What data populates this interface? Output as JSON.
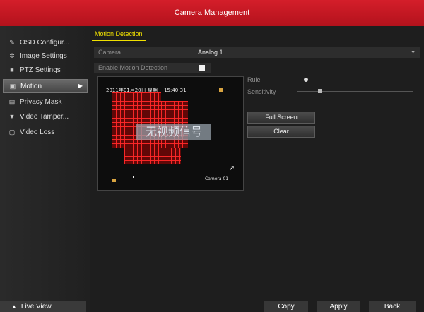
{
  "window": {
    "title": "Camera Management"
  },
  "sidebar": {
    "items": [
      {
        "icon": "pencil-icon",
        "label": "OSD Configur..."
      },
      {
        "icon": "image-settings-icon",
        "label": "Image Settings"
      },
      {
        "icon": "ptz-icon",
        "label": "PTZ Settings"
      },
      {
        "icon": "motion-icon",
        "label": "Motion"
      },
      {
        "icon": "privacy-mask-icon",
        "label": "Privacy Mask"
      },
      {
        "icon": "tamper-icon",
        "label": "Video Tamper..."
      },
      {
        "icon": "video-loss-icon",
        "label": "Video Loss"
      }
    ],
    "live_view": "Live View"
  },
  "tab": {
    "label": "Motion Detection"
  },
  "form": {
    "camera_label": "Camera",
    "camera_value": "Analog 1",
    "enable_label": "Enable Motion Detection",
    "enable_checked": true
  },
  "preview": {
    "timestamp": "2011年01月20日 星期一 15:40:31",
    "no_signal": "无视频信号",
    "camera_name": "Camera 01"
  },
  "right_panel": {
    "rule_label": "Rule",
    "sensitivity_label": "Sensitivity",
    "sensitivity_level": 0.2,
    "full_screen_label": "Full Screen",
    "clear_label": "Clear"
  },
  "bottom": {
    "copy_label": "Copy",
    "apply_label": "Apply",
    "back_label": "Back"
  }
}
